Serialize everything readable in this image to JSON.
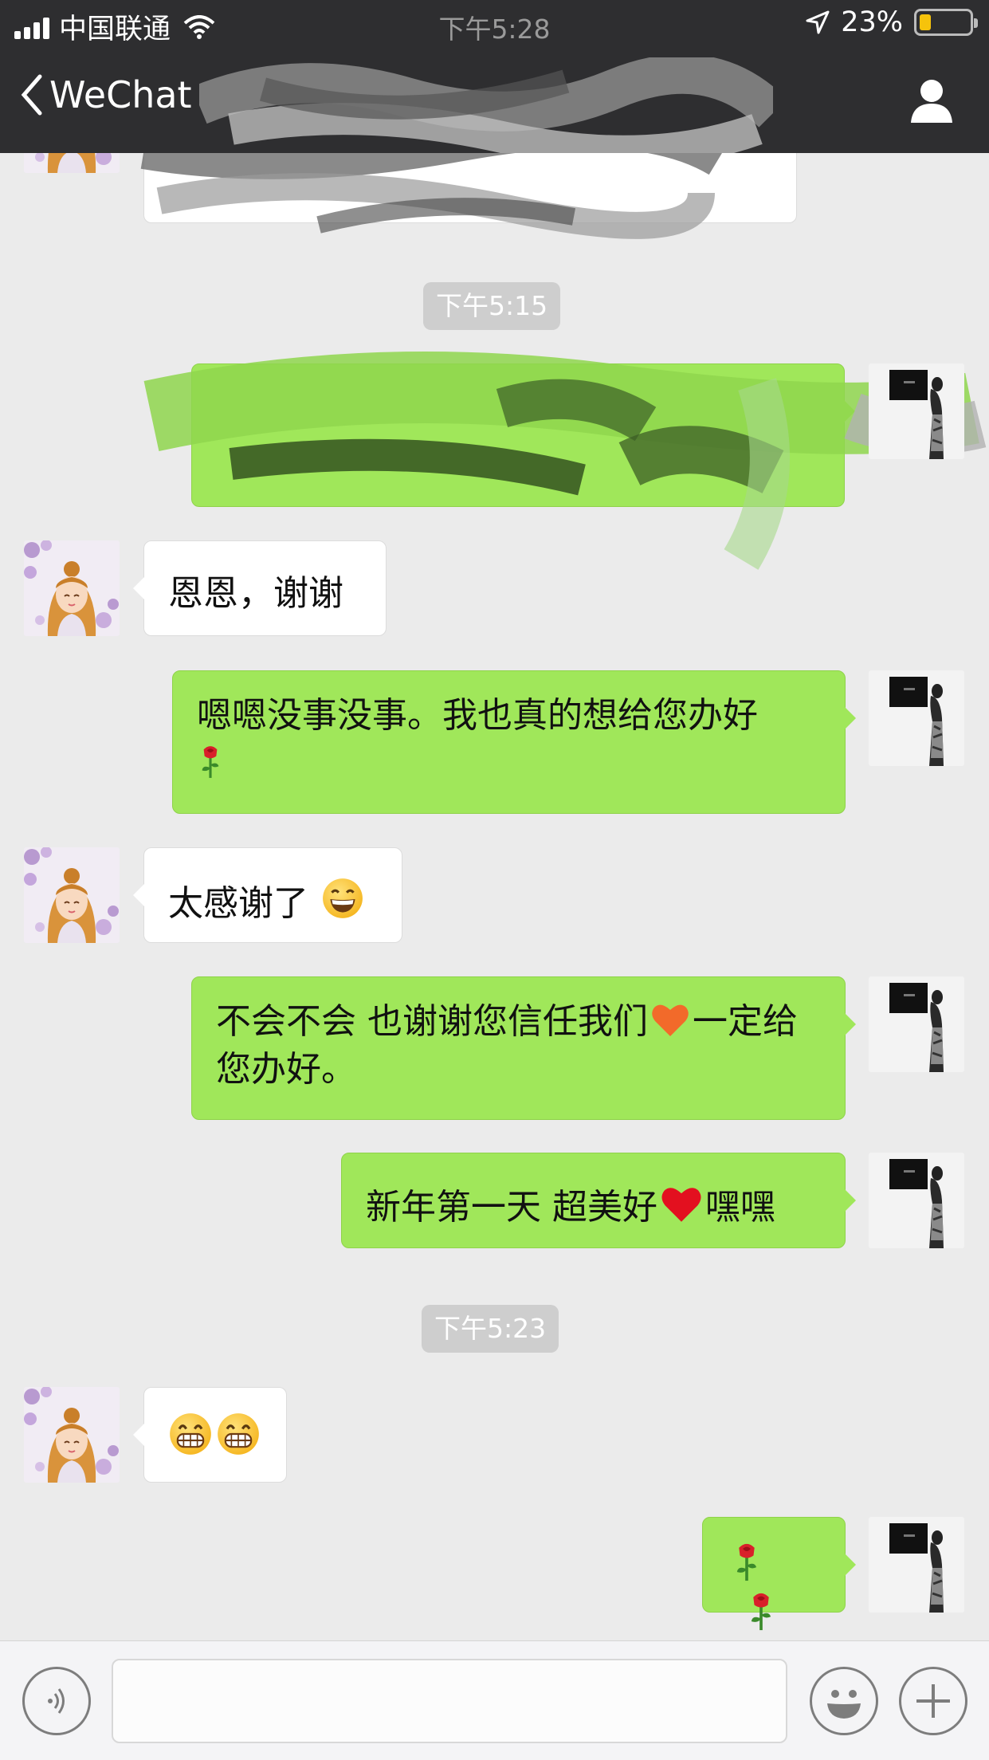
{
  "status_bar": {
    "carrier": "中国联通",
    "time": "下午5:28",
    "battery_percent": "23%",
    "battery_level": 0.23,
    "battery_color": "#f6c30b"
  },
  "nav": {
    "back_label": "WeChat",
    "contact_icon": "person-icon"
  },
  "timestamps": [
    "下午5:15",
    "下午5:23"
  ],
  "messages": [
    {
      "side": "in",
      "text": "恩恩，谢谢"
    },
    {
      "side": "out",
      "text": "嗯嗯没事没事。我也真的想给您办好"
    },
    {
      "side": "in",
      "text": "太感谢了"
    },
    {
      "side": "out",
      "text_a": "不会不会 也谢谢您信任我们",
      "text_b": "一定给您办好。"
    },
    {
      "side": "out",
      "text_a": "新年第一天 超美好",
      "text_b": "嘿嘿"
    },
    {
      "side": "in",
      "text": ""
    },
    {
      "side": "out",
      "text": ""
    }
  ],
  "icons": {
    "rose": "rose-emoji-icon",
    "grin": "grinning-face-emoji-icon",
    "beam": "beaming-face-emoji-icon",
    "orange_heart": "orange-heart-emoji-icon",
    "red_heart": "red-heart-emoji-icon"
  },
  "colors": {
    "nav_bg": "#2e2e30",
    "chat_bg": "#ebebeb",
    "bubble_out": "#a0e75a",
    "bubble_in": "#ffffff"
  }
}
